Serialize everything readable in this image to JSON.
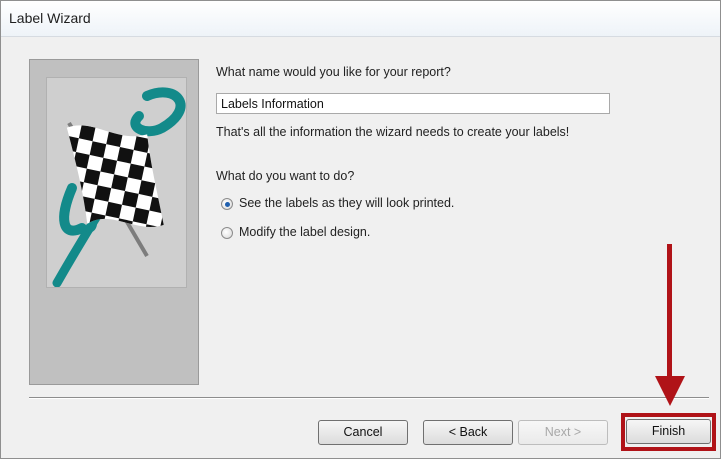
{
  "window": {
    "title": "Label Wizard"
  },
  "form": {
    "name_prompt": "What name would you like for your report?",
    "report_name_value": "Labels Information",
    "info_text": "That's all the information the wizard needs to create your labels!",
    "action_prompt": "What do you want to do?",
    "options": [
      {
        "label": "See the labels as they will look printed.",
        "selected": true
      },
      {
        "label": "Modify the label design.",
        "selected": false
      }
    ]
  },
  "buttons": {
    "cancel": "Cancel",
    "back": "< Back",
    "next": "Next >",
    "finish": "Finish"
  },
  "colors": {
    "highlight": "#b01318",
    "teal": "#138a8a"
  },
  "icons": {
    "wizard_image": "checkered-flag-icon",
    "annotation": "red-arrow-icon"
  }
}
